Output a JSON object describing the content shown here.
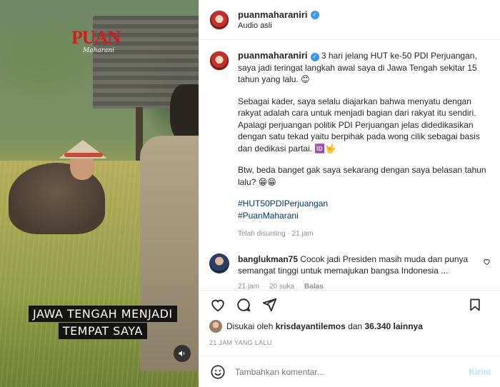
{
  "media": {
    "logo_title": "PUAN",
    "logo_subtitle": "Maharani",
    "caption_line1": "JAWA TENGAH MENJADI",
    "caption_line2": "TEMPAT SAYA",
    "volume_icon": "speaker-icon"
  },
  "header": {
    "username": "puanmaharaniri",
    "verified": true,
    "subtitle": "Audio asli"
  },
  "post_caption": {
    "username": "puanmaharaniri",
    "paragraph1": "3 hari jelang HUT ke-50 PDI Perjuangan, saya jadi teringat langkah awal saya di Jawa Tengah sekitar 15 tahun yang lalu. 😊",
    "paragraph2": "Sebagai kader, saya selalu diajarkan bahwa menyatu dengan rakyat adalah cara untuk menjadi bagian dari rakyat itu sendiri. Apalagi perjuangan politik PDI Perjuangan jelas didedikasikan dengan satu tekad yaitu berpihak pada wong cilik sebagai basis dan dedikasi partai. 🆔🤟",
    "paragraph3": "Btw, beda banget gak saya sekarang dengan saya belasan tahun lalu? 😁😁",
    "hashtags": [
      "#HUT50PDIPerjuangan",
      "#PuanMaharani"
    ],
    "meta": "Telah disunting · 21 jam"
  },
  "comment": {
    "username": "banglukman75",
    "text": "Cocok jadi Presiden masih muda dan punya semangat tinggi untuk memajukan bangsa Indonesia ...",
    "time": "21 jam",
    "likes": "20 suka",
    "reply": "Balas"
  },
  "likes": {
    "prefix": "Disukai oleh",
    "user": "krisdayantilemos",
    "middle": "dan",
    "count": "36.340 lainnya"
  },
  "date": "21 JAM YANG LALU",
  "add_comment": {
    "placeholder": "Tambahkan komentar...",
    "send": "Kirim"
  },
  "colors": {
    "link": "#00376b",
    "verified": "#3897f0",
    "send_disabled": "#b2dffc",
    "logo_red": "#d01c1f"
  }
}
